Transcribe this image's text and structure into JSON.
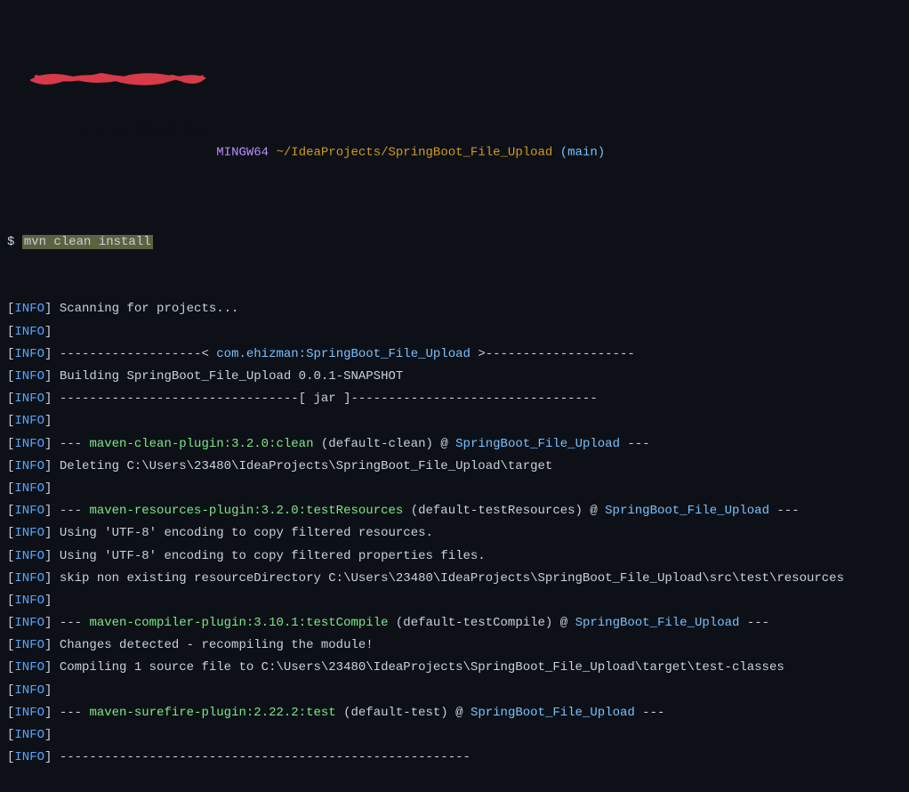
{
  "prompt": {
    "user_host": "REDACTED@HOSTNAME",
    "mingw": "MINGW64",
    "path": "~/IdeaProjects/SpringBoot_File_Upload",
    "branch": "(main)",
    "prompt_char": "$",
    "command": "mvn clean install"
  },
  "lines": [
    {
      "type": "info",
      "text": "Scanning for projects..."
    },
    {
      "type": "info",
      "text": ""
    },
    {
      "type": "info-proj",
      "dashes1": "-------------------<",
      "proj": "com.ehizman:SpringBoot_File_Upload",
      "dashes2": ">--------------------"
    },
    {
      "type": "info",
      "text": "Building SpringBoot_File_Upload 0.0.1-SNAPSHOT"
    },
    {
      "type": "info",
      "text": "--------------------------------[ jar ]---------------------------------"
    },
    {
      "type": "info",
      "text": ""
    },
    {
      "type": "info-plugin",
      "prefix": "--- ",
      "plugin": "maven-clean-plugin:3.2.0:clean",
      "paren": "(default-clean)",
      "at": "@",
      "target": "SpringBoot_File_Upload",
      "suffix": " ---"
    },
    {
      "type": "info",
      "text": "Deleting C:\\Users\\23480\\IdeaProjects\\SpringBoot_File_Upload\\target"
    },
    {
      "type": "info",
      "text": ""
    },
    {
      "type": "info-plugin",
      "prefix": "--- ",
      "plugin": "maven-resources-plugin:3.2.0:testResources",
      "paren": "(default-testResources)",
      "at": "@",
      "target": "SpringBoot_File_Upload",
      "suffix": " ---"
    },
    {
      "type": "info",
      "text": "Using 'UTF-8' encoding to copy filtered resources."
    },
    {
      "type": "info",
      "text": "Using 'UTF-8' encoding to copy filtered properties files."
    },
    {
      "type": "info",
      "text": "skip non existing resourceDirectory C:\\Users\\23480\\IdeaProjects\\SpringBoot_File_Upload\\src\\test\\resources"
    },
    {
      "type": "info",
      "text": ""
    },
    {
      "type": "info-plugin",
      "prefix": "--- ",
      "plugin": "maven-compiler-plugin:3.10.1:testCompile",
      "paren": "(default-testCompile)",
      "at": "@",
      "target": "SpringBoot_File_Upload",
      "suffix": " ---"
    },
    {
      "type": "info",
      "text": "Changes detected - recompiling the module!"
    },
    {
      "type": "info",
      "text": "Compiling 1 source file to C:\\Users\\23480\\IdeaProjects\\SpringBoot_File_Upload\\target\\test-classes"
    },
    {
      "type": "info",
      "text": ""
    },
    {
      "type": "info-plugin",
      "prefix": "--- ",
      "plugin": "maven-surefire-plugin:2.22.2:test",
      "paren": "(default-test)",
      "at": "@",
      "target": "SpringBoot_File_Upload",
      "suffix": " ---"
    },
    {
      "type": "info",
      "text": ""
    },
    {
      "type": "info",
      "text": "-------------------------------------------------------"
    }
  ],
  "labels": {
    "info": "INFO"
  }
}
